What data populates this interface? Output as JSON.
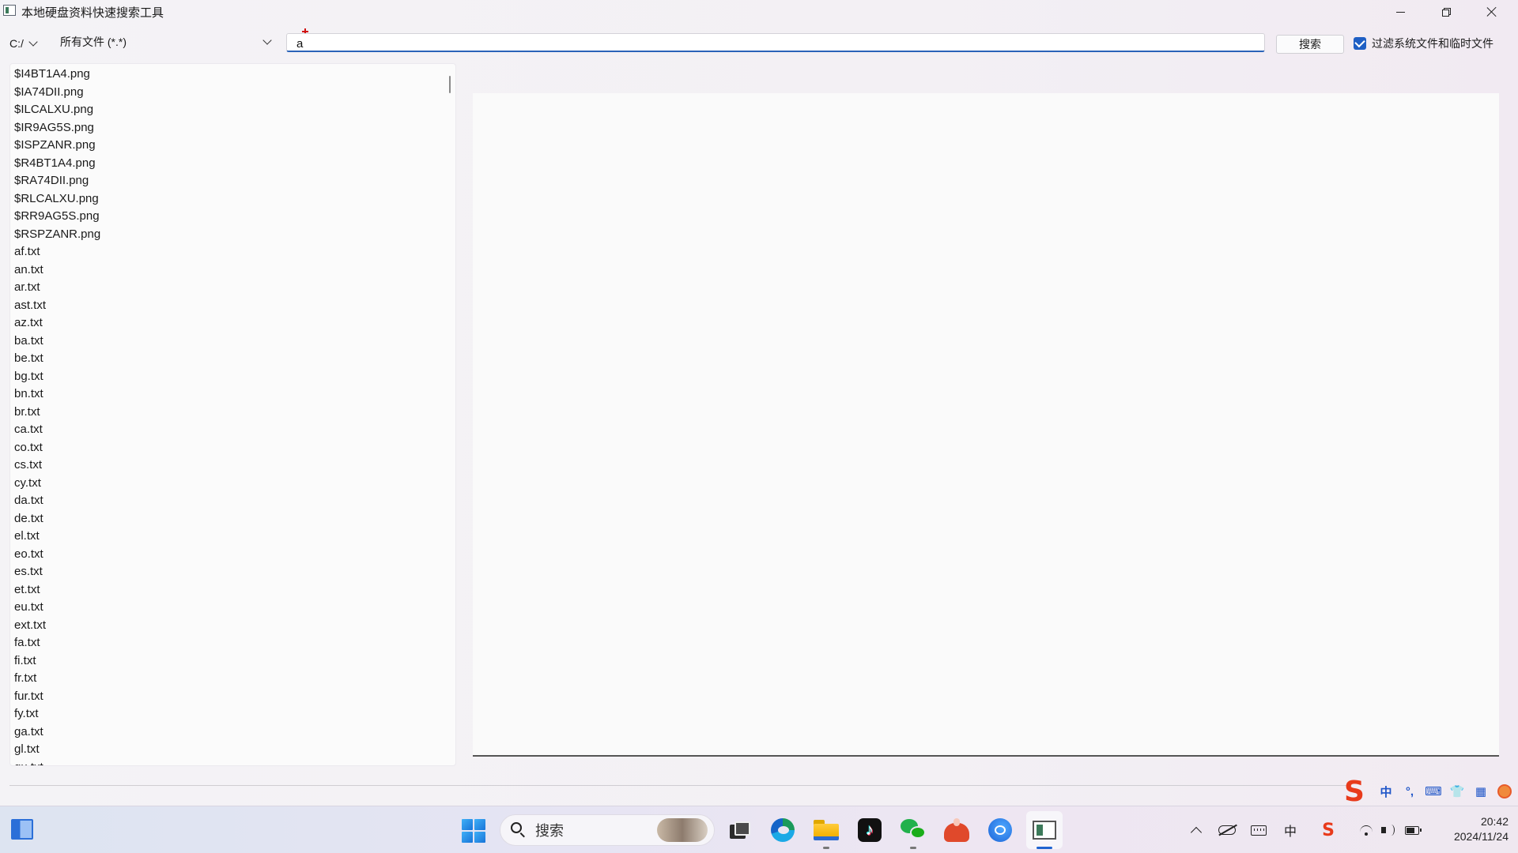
{
  "window": {
    "title": "本地硬盘资料快速搜索工具"
  },
  "toolbar": {
    "drive": "C:/",
    "file_type": "所有文件 (*.*)",
    "search_value": "a",
    "search_button": "搜索",
    "filter_label": "过滤系统文件和临时文件",
    "filter_checked": true
  },
  "files": [
    "$I4BT1A4.png",
    "$IA74DII.png",
    "$ILCALXU.png",
    "$IR9AG5S.png",
    "$ISPZANR.png",
    "$R4BT1A4.png",
    "$RA74DII.png",
    "$RLCALXU.png",
    "$RR9AG5S.png",
    "$RSPZANR.png",
    "af.txt",
    "an.txt",
    "ar.txt",
    "ast.txt",
    "az.txt",
    "ba.txt",
    "be.txt",
    "bg.txt",
    "bn.txt",
    "br.txt",
    "ca.txt",
    "co.txt",
    "cs.txt",
    "cy.txt",
    "da.txt",
    "de.txt",
    "el.txt",
    "eo.txt",
    "es.txt",
    "et.txt",
    "eu.txt",
    "ext.txt",
    "fa.txt",
    "fi.txt",
    "fr.txt",
    "fur.txt",
    "fy.txt",
    "ga.txt",
    "gl.txt",
    "gu.txt"
  ],
  "ime": {
    "mode": "中",
    "punct": "°,"
  },
  "taskbar": {
    "search_placeholder": "搜索",
    "tray_ime": "中",
    "time": "20:42",
    "date": "2024/11/24"
  },
  "colors": {
    "accent": "#1f5fc4",
    "input_underline": "#2a63b8",
    "ime_brand": "#e83a1b"
  }
}
